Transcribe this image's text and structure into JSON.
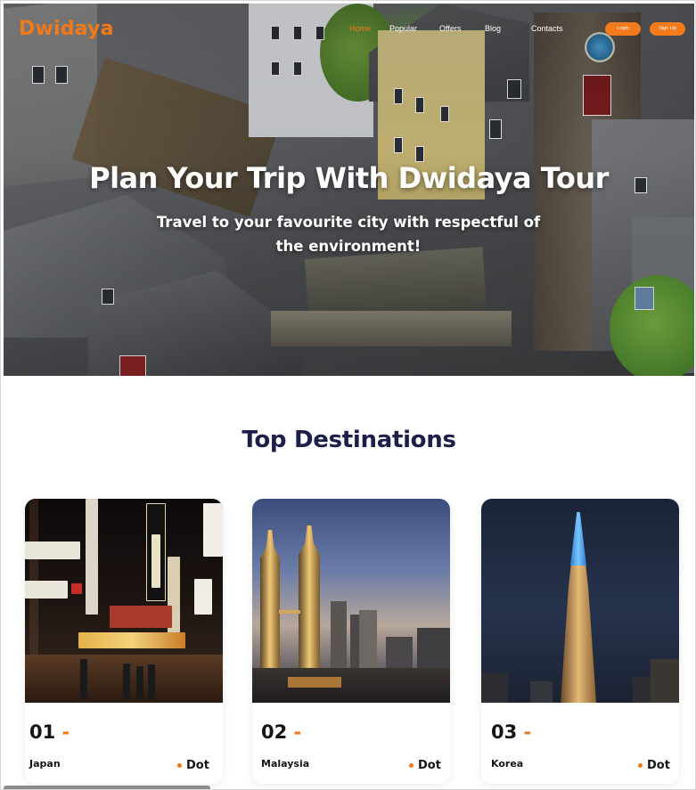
{
  "brand": {
    "logo": "Dwidaya",
    "accent": "#f07a19"
  },
  "nav": {
    "items": [
      {
        "label": "Home",
        "active": true
      },
      {
        "label": "Popular",
        "active": false
      },
      {
        "label": "Offers",
        "active": false
      },
      {
        "label": "Blog",
        "active": false
      },
      {
        "label": "Contacts",
        "active": false
      }
    ],
    "login_label": "Login",
    "signup_label": "Sign Up"
  },
  "hero": {
    "title": "Plan Your Trip With Dwidaya Tour",
    "subtitle": "Travel to your favourite city with respectful of the environment!",
    "image": "aerial-old-town-canal-photo"
  },
  "destinations": {
    "heading": "Top Destinations",
    "cards": [
      {
        "number": "01",
        "dash": "-",
        "city": "Japan",
        "tag": "Dot",
        "image": "tokyo-night-street-photo"
      },
      {
        "number": "02",
        "dash": "-",
        "city": "Malaysia",
        "tag": "Dot",
        "image": "petronas-towers-photo"
      },
      {
        "number": "03",
        "dash": "-",
        "city": "Korea",
        "tag": "Dot",
        "image": "lotte-tower-night-photo"
      }
    ]
  }
}
